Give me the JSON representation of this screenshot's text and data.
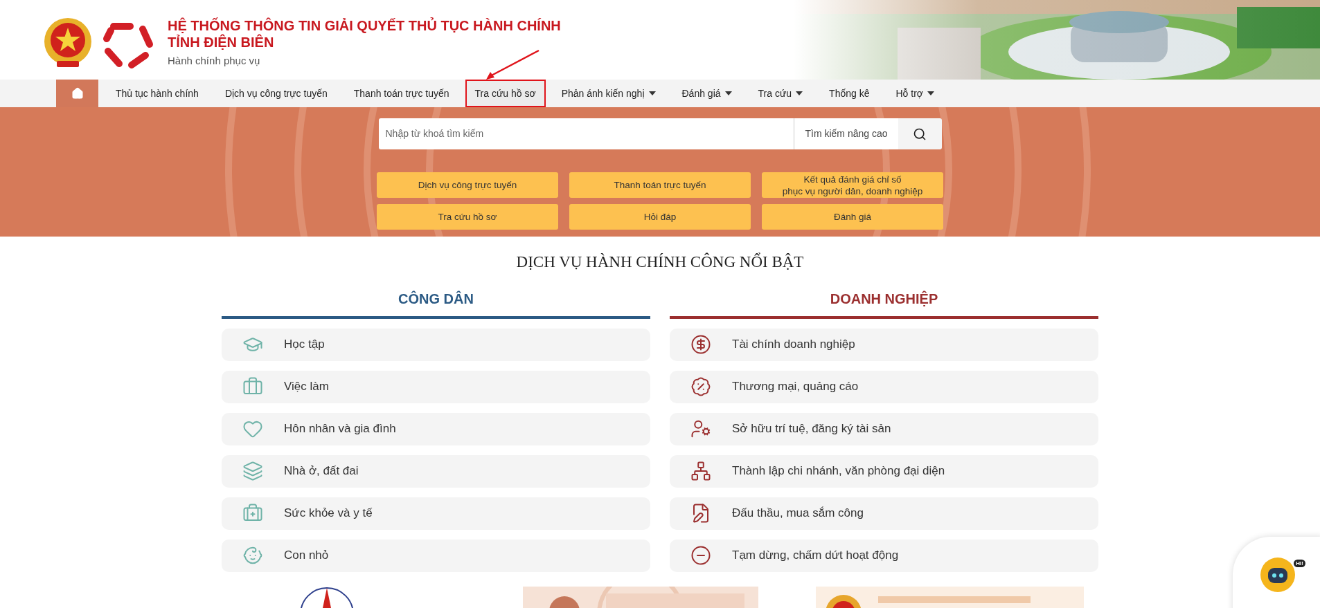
{
  "header": {
    "title_line_1": "HỆ THỐNG THÔNG TIN GIẢI QUYẾT THỦ TỤC HÀNH CHÍNH",
    "title_line_2": "TỈNH ĐIỆN BIÊN",
    "subtitle": "Hành chính phục vụ"
  },
  "nav": [
    {
      "label": "Thủ tục hành chính",
      "dropdown": false,
      "highlighted": false
    },
    {
      "label": "Dịch vụ công trực tuyến",
      "dropdown": false,
      "highlighted": false
    },
    {
      "label": "Thanh toán trực tuyến",
      "dropdown": false,
      "highlighted": false
    },
    {
      "label": "Tra cứu hồ sơ",
      "dropdown": false,
      "highlighted": true
    },
    {
      "label": "Phản ánh kiến nghị",
      "dropdown": true,
      "highlighted": false
    },
    {
      "label": "Đánh giá",
      "dropdown": true,
      "highlighted": false
    },
    {
      "label": "Tra cứu",
      "dropdown": true,
      "highlighted": false
    },
    {
      "label": "Thống kê",
      "dropdown": false,
      "highlighted": false
    },
    {
      "label": "Hỗ trợ",
      "dropdown": true,
      "highlighted": false
    }
  ],
  "search": {
    "placeholder": "Nhập từ khoá tìm kiếm",
    "advanced": "Tìm kiếm nâng cao"
  },
  "quick_links": [
    [
      "Dịch vụ công trực tuyến"
    ],
    [
      "Thanh toán trực tuyến"
    ],
    [
      "Kết quả đánh giá chỉ số",
      "phục vụ người dân, doanh nghiệp"
    ],
    [
      "Tra cứu hồ sơ"
    ],
    [
      "Hỏi đáp"
    ],
    [
      "Đánh giá"
    ]
  ],
  "section_title": "DỊCH VỤ HÀNH CHÍNH CÔNG NỔI BẬT",
  "groups": [
    {
      "title": "CÔNG DÂN",
      "color": "#2b5a84",
      "items": [
        "Học tập",
        "Việc làm",
        "Hôn nhân và gia đình",
        "Nhà ở, đất đai",
        "Sức khỏe và y tế",
        "Con nhỏ"
      ]
    },
    {
      "title": "DOANH NGHIỆP",
      "color": "#9b2f2f",
      "items": [
        "Tài chính doanh nghiệp",
        "Thương mại, quảng cáo",
        "Sở hữu trí tuệ, đăng ký tài sản",
        "Thành lập chi nhánh, văn phòng đại diện",
        "Đấu thầu, mua sắm công",
        "Tạm dừng, chấm dứt hoạt động"
      ]
    }
  ],
  "chatbot": {
    "badge": "HI!"
  }
}
